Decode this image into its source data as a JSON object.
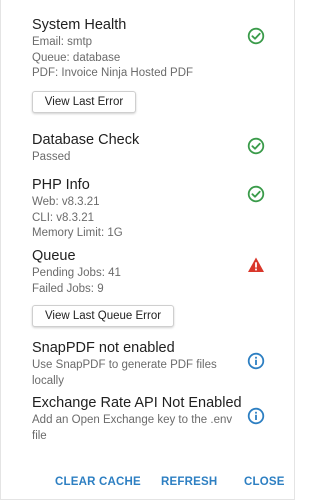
{
  "colors": {
    "ok": "#3a9b4a",
    "warning": "#d9372b",
    "info": "#2d7fc2",
    "accent": "#2d7fc2"
  },
  "system_health": {
    "title": "System Health",
    "lines": [
      "Email: smtp",
      "Queue: database",
      "PDF: Invoice Ninja Hosted PDF"
    ],
    "status_icon": "check-circle-icon",
    "button": "View Last Error"
  },
  "database_check": {
    "title": "Database Check",
    "lines": [
      "Passed"
    ],
    "status_icon": "check-circle-icon"
  },
  "php_info": {
    "title": "PHP Info",
    "lines": [
      "Web: v8.3.21",
      "CLI: v8.3.21",
      "Memory Limit: 1G"
    ],
    "status_icon": "check-circle-icon"
  },
  "queue": {
    "title": "Queue",
    "lines": [
      "Pending Jobs: 41",
      "Failed Jobs: 9"
    ],
    "status_icon": "warning-triangle-icon",
    "button": "View Last Queue Error"
  },
  "snappdf": {
    "title": "SnapPDF not enabled",
    "description": "Use SnapPDF to generate PDF files locally",
    "status_icon": "info-circle-icon"
  },
  "exchange_rate": {
    "title": "Exchange Rate API Not Enabled",
    "description": "Add an Open Exchange key to the .env file",
    "status_icon": "info-circle-icon"
  },
  "footer": {
    "clear_cache": "CLEAR CACHE",
    "refresh": "REFRESH",
    "close": "CLOSE"
  }
}
